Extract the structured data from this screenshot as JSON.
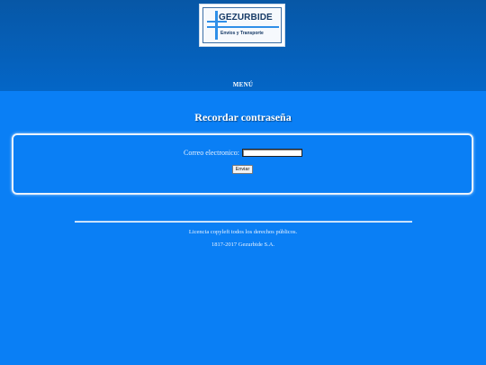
{
  "header": {
    "logo": {
      "title": "GEZURBIDE",
      "subtitle": "Envíos y Transporte"
    },
    "menu_label": "MENÚ"
  },
  "main": {
    "title": "Recordar contraseña",
    "form": {
      "email_label": "Correo electronico:",
      "email_value": "",
      "submit_label": "Enviar"
    }
  },
  "footer": {
    "license": "Licencia copyleft todos los derechos públicos.",
    "copyright": "1817-2017 Gezurbide S.A."
  },
  "colors": {
    "header_bg": "#0466c7",
    "page_bg": "#0a7ff5",
    "panel_border": "#e9f2fc"
  }
}
